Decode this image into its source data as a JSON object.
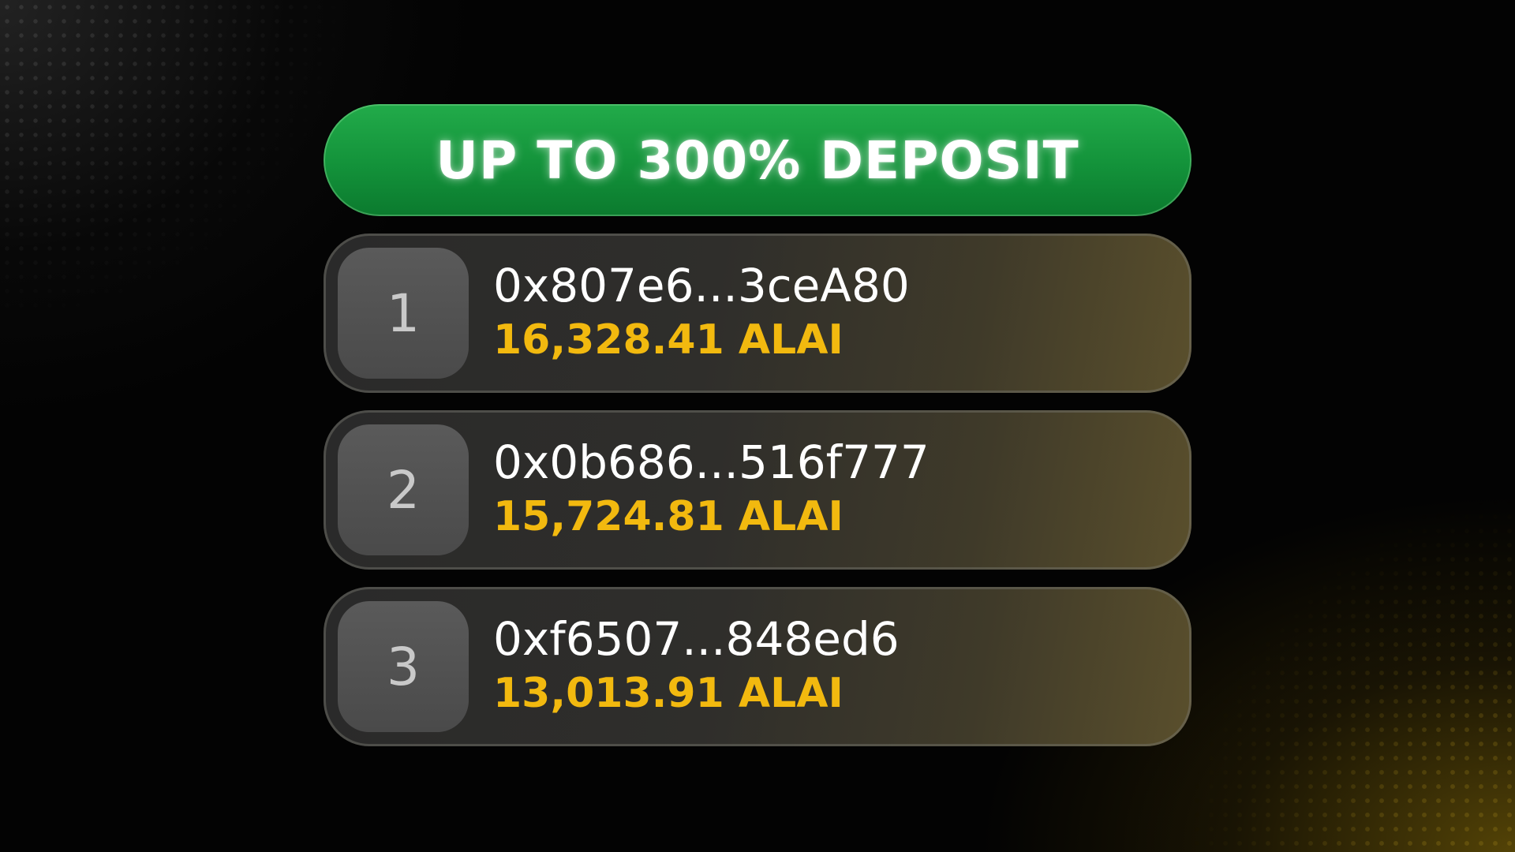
{
  "banner": {
    "title": "UP TO 300% DEPOSIT"
  },
  "leaderboard": [
    {
      "rank": "1",
      "address": "0x807e6...3ceA80",
      "amount": "16,328.41 ALAI"
    },
    {
      "rank": "2",
      "address": "0x0b686...516f777",
      "amount": "15,724.81 ALAI"
    },
    {
      "rank": "3",
      "address": "0xf6507...848ed6",
      "amount": "13,013.91 ALAI"
    }
  ],
  "colors": {
    "banner_green": "#13923a",
    "amount_gold": "#f2b90f",
    "row_background": "#2f2e2b",
    "rank_tile": "#4f4f4f"
  }
}
